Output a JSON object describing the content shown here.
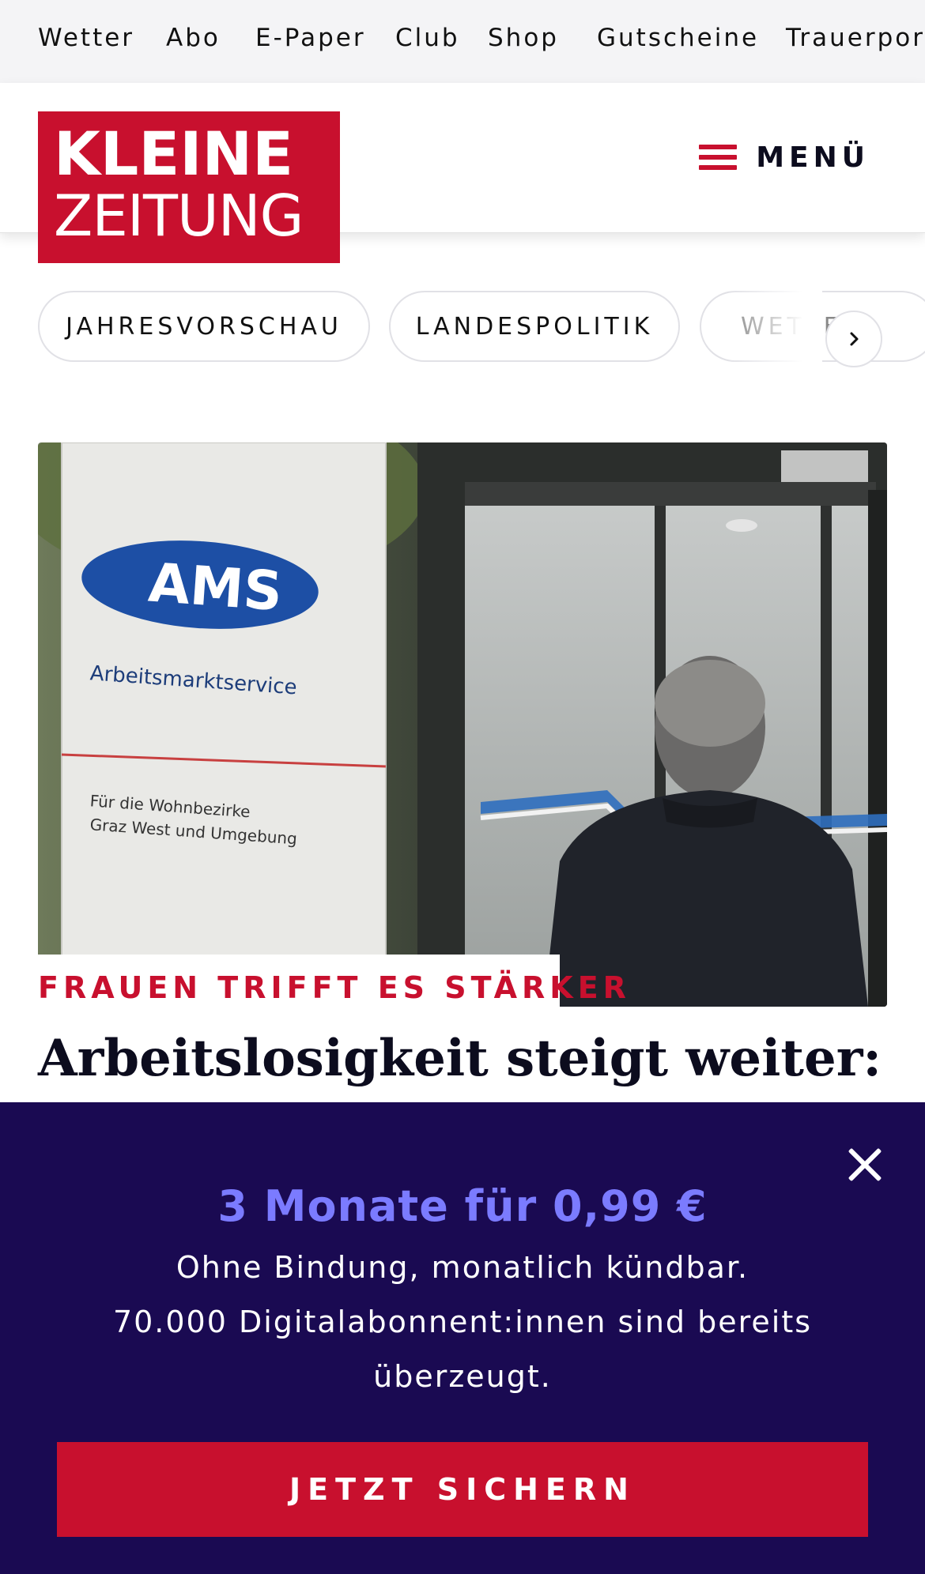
{
  "topnav": {
    "items": [
      "Wetter",
      "Abo",
      "E-Paper",
      "Club",
      "Shop",
      "Gutscheine",
      "Trauerportal"
    ]
  },
  "header": {
    "logo_line1": "KLEINE",
    "logo_line2": "ZEITUNG",
    "menu_label": "MENÜ"
  },
  "topics": {
    "items": [
      "JAHRESVORSCHAU",
      "LANDESPOLITIK",
      "WETTER"
    ]
  },
  "article": {
    "image_sign_brand": "AMS",
    "image_sign_name": "Arbeitsmarktservice",
    "image_sign_line1": "Für die Wohnbezirke",
    "image_sign_line2": "Graz West und Umgebung",
    "kicker": "FRAUEN TRIFFT ES STÄRKER",
    "headline": "Arbeitslosigkeit steigt weiter:"
  },
  "promo": {
    "offer": "3 Monate für 0,99 €",
    "line1": "Ohne Bindung, monatlich kündbar.",
    "line2": "70.000 Digitalabonnent:innen sind bereits überzeugt.",
    "cta": "JETZT SICHERN"
  },
  "colors": {
    "brand_red": "#c8102e",
    "promo_bg": "#1a0a52",
    "offer_blue": "#7b7bff"
  }
}
